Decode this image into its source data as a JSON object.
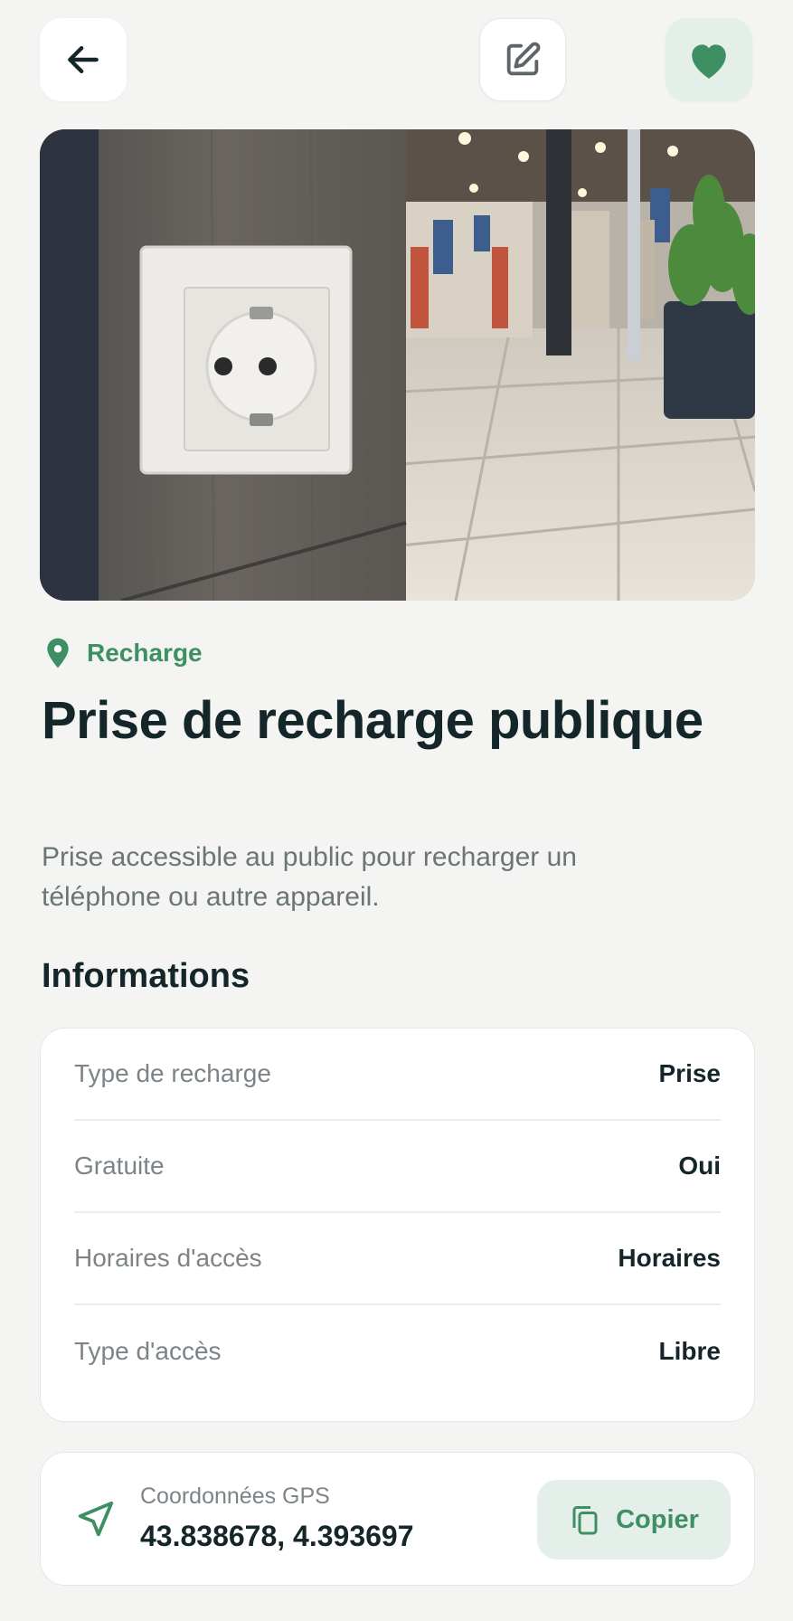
{
  "header": {
    "back_icon": "arrow-left-icon",
    "edit_icon": "edit-icon",
    "favorite_icon": "heart-icon"
  },
  "category": {
    "icon": "map-pin-icon",
    "label": "Recharge",
    "color": "#3f8f64"
  },
  "place": {
    "title": "Prise de recharge publique",
    "description": "Prise accessible au public pour recharger un téléphone ou autre appareil."
  },
  "info": {
    "heading": "Informations",
    "rows": [
      {
        "label": "Type de recharge",
        "value": "Prise"
      },
      {
        "label": "Gratuite",
        "value": "Oui"
      },
      {
        "label": "Horaires d'accès",
        "value": "Horaires"
      },
      {
        "label": "Type d'accès",
        "value": "Libre"
      }
    ]
  },
  "gps": {
    "icon": "navigation-icon",
    "label": "Coordonnées GPS",
    "value": "43.838678, 4.393697",
    "copy_label": "Copier",
    "copy_icon": "copy-icon"
  },
  "colors": {
    "accent": "#3f8f64",
    "accent_bg": "#e3efe8",
    "background": "#f4f5f3",
    "text": "#15262a",
    "muted": "#7c8487"
  }
}
